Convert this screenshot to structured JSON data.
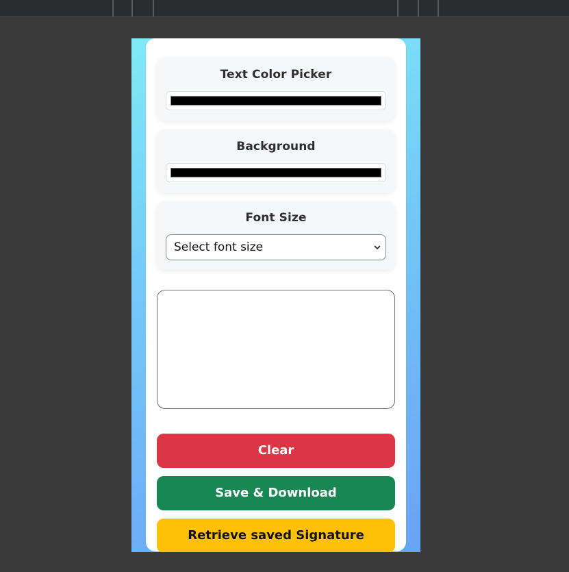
{
  "text_color": {
    "title": "Text Color Picker",
    "value": "#000000"
  },
  "background": {
    "title": "Background",
    "value": "#000000"
  },
  "font_size": {
    "title": "Font Size",
    "selected": "Select font size"
  },
  "buttons": {
    "clear": "Clear",
    "save": "Save & Download",
    "retrieve": "Retrieve saved Signature"
  },
  "colors": {
    "clear": "#dc3545",
    "save": "#198754",
    "retrieve": "#ffc107",
    "gradient_start": "#7feaf6",
    "gradient_end": "#6aa2f6"
  },
  "icons": {
    "select_arrow": "chevron-down-icon"
  }
}
